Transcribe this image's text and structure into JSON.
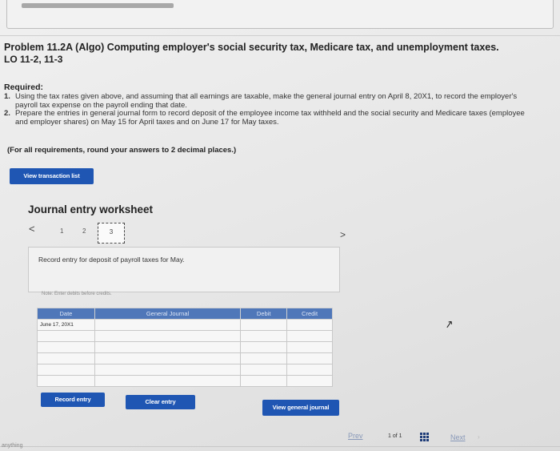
{
  "problem": {
    "title": "Problem 11.2A (Algo) Computing employer's social security tax, Medicare tax, and unemployment taxes.",
    "lo": "LO 11-2, 11-3",
    "required_label": "Required:",
    "requirements": [
      {
        "num": "1.",
        "text": "Using the tax rates given above, and assuming that all earnings are taxable, make the general journal entry on April 8, 20X1, to record the employer's payroll tax expense on the payroll ending that date."
      },
      {
        "num": "2.",
        "text": "Prepare the entries in general journal form to record deposit of the employee income tax withheld and the social security and Medicare taxes (employee and employer shares) on May 15 for April taxes and on June 17 for May taxes."
      }
    ],
    "rounding_note": "(For all requirements, round your answers to 2 decimal places.)"
  },
  "buttons": {
    "view_transaction_list": "View transaction list",
    "record_entry": "Record entry",
    "clear_entry": "Clear entry",
    "view_general_journal": "View general journal"
  },
  "worksheet": {
    "title": "Journal entry worksheet",
    "prev_arrow": "<",
    "next_arrow": ">",
    "steps": [
      "1",
      "2",
      "3"
    ],
    "instruction": "Record entry for deposit of payroll taxes for May.",
    "note": "Note: Enter debits before credits."
  },
  "journal_table": {
    "headers": [
      "Date",
      "General Journal",
      "Debit",
      "Credit"
    ],
    "rows": [
      [
        "June 17, 20X1",
        "",
        "",
        ""
      ],
      [
        "",
        "",
        "",
        ""
      ],
      [
        "",
        "",
        "",
        ""
      ],
      [
        "",
        "",
        "",
        ""
      ],
      [
        "",
        "",
        "",
        ""
      ],
      [
        "",
        "",
        "",
        ""
      ]
    ]
  },
  "pager": {
    "prev": "Prev",
    "count": "1 of 1",
    "next": "Next"
  },
  "footer_text": "anything",
  "colors": {
    "primary_button": "#1f56b3",
    "table_header": "#4f77b9"
  }
}
